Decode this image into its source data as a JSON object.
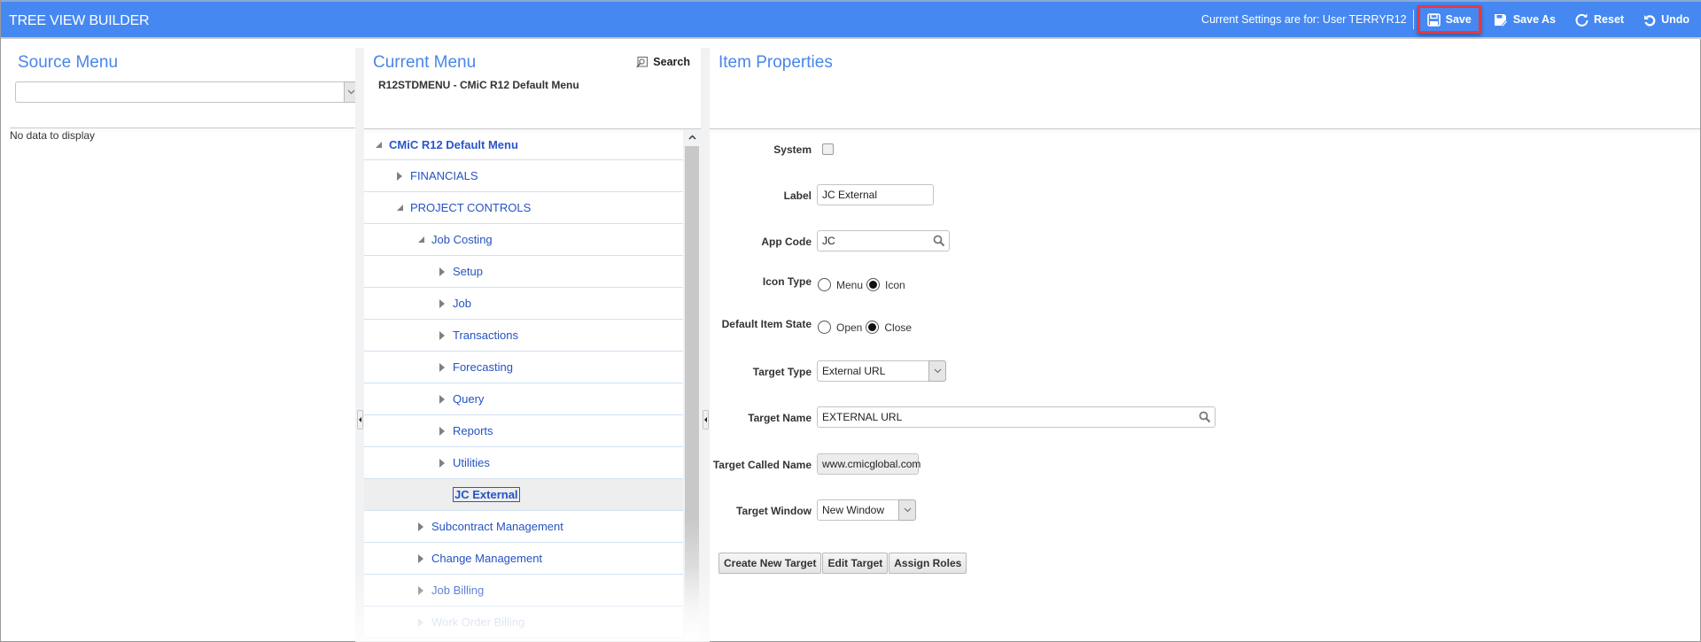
{
  "header": {
    "title": "TREE VIEW BUILDER",
    "settings_text": "Current Settings are for: User TERRYR12",
    "buttons": {
      "save": "Save",
      "save_as": "Save As",
      "reset": "Reset",
      "undo": "Undo"
    },
    "highlight_color": "#e8383d",
    "bar_color": "#4688f1"
  },
  "source_menu": {
    "title": "Source Menu",
    "select_value": "",
    "empty_text": "No data to display"
  },
  "current_menu": {
    "title": "Current Menu",
    "menu_code": "R12STDMENU - CMiC R12 Default Menu",
    "search_label": "Search",
    "tree": [
      {
        "label": "CMiC R12 Default Menu",
        "level": 0,
        "state": "expanded"
      },
      {
        "label": "FINANCIALS",
        "level": 1,
        "state": "collapsed"
      },
      {
        "label": "PROJECT CONTROLS",
        "level": 1,
        "state": "expanded"
      },
      {
        "label": "Job Costing",
        "level": 2,
        "state": "expanded"
      },
      {
        "label": "Setup",
        "level": 3,
        "state": "collapsed"
      },
      {
        "label": "Job",
        "level": 3,
        "state": "collapsed"
      },
      {
        "label": "Transactions",
        "level": 3,
        "state": "collapsed"
      },
      {
        "label": "Forecasting",
        "level": 3,
        "state": "collapsed"
      },
      {
        "label": "Query",
        "level": 3,
        "state": "collapsed"
      },
      {
        "label": "Reports",
        "level": 3,
        "state": "collapsed"
      },
      {
        "label": "Utilities",
        "level": 3,
        "state": "collapsed"
      },
      {
        "label": "JC External",
        "level": 3,
        "state": "leaf",
        "selected": true
      },
      {
        "label": "Subcontract Management",
        "level": 2,
        "state": "collapsed"
      },
      {
        "label": "Change Management",
        "level": 2,
        "state": "collapsed"
      },
      {
        "label": "Job Billing",
        "level": 2,
        "state": "collapsed"
      },
      {
        "label": "Work Order Billing",
        "level": 2,
        "state": "collapsed"
      }
    ]
  },
  "item_properties": {
    "title": "Item Properties",
    "system": {
      "label": "System",
      "checked": false
    },
    "label_field": {
      "label": "Label",
      "value": "JC External"
    },
    "app_code": {
      "label": "App Code",
      "value": "JC"
    },
    "icon_type": {
      "label": "Icon Type",
      "options": [
        "Menu",
        "Icon"
      ],
      "selected": "Icon"
    },
    "default_item_state": {
      "label": "Default Item State",
      "options": [
        "Open",
        "Close"
      ],
      "selected": "Close"
    },
    "target_type": {
      "label": "Target Type",
      "value": "External URL"
    },
    "target_name": {
      "label": "Target Name",
      "value": "EXTERNAL URL"
    },
    "target_called_name": {
      "label": "Target Called Name",
      "value": "www.cmicglobal.com"
    },
    "target_window": {
      "label": "Target Window",
      "value": "New Window"
    },
    "buttons": {
      "create_new_target": "Create New Target",
      "edit_target": "Edit Target",
      "assign_roles": "Assign Roles"
    }
  }
}
